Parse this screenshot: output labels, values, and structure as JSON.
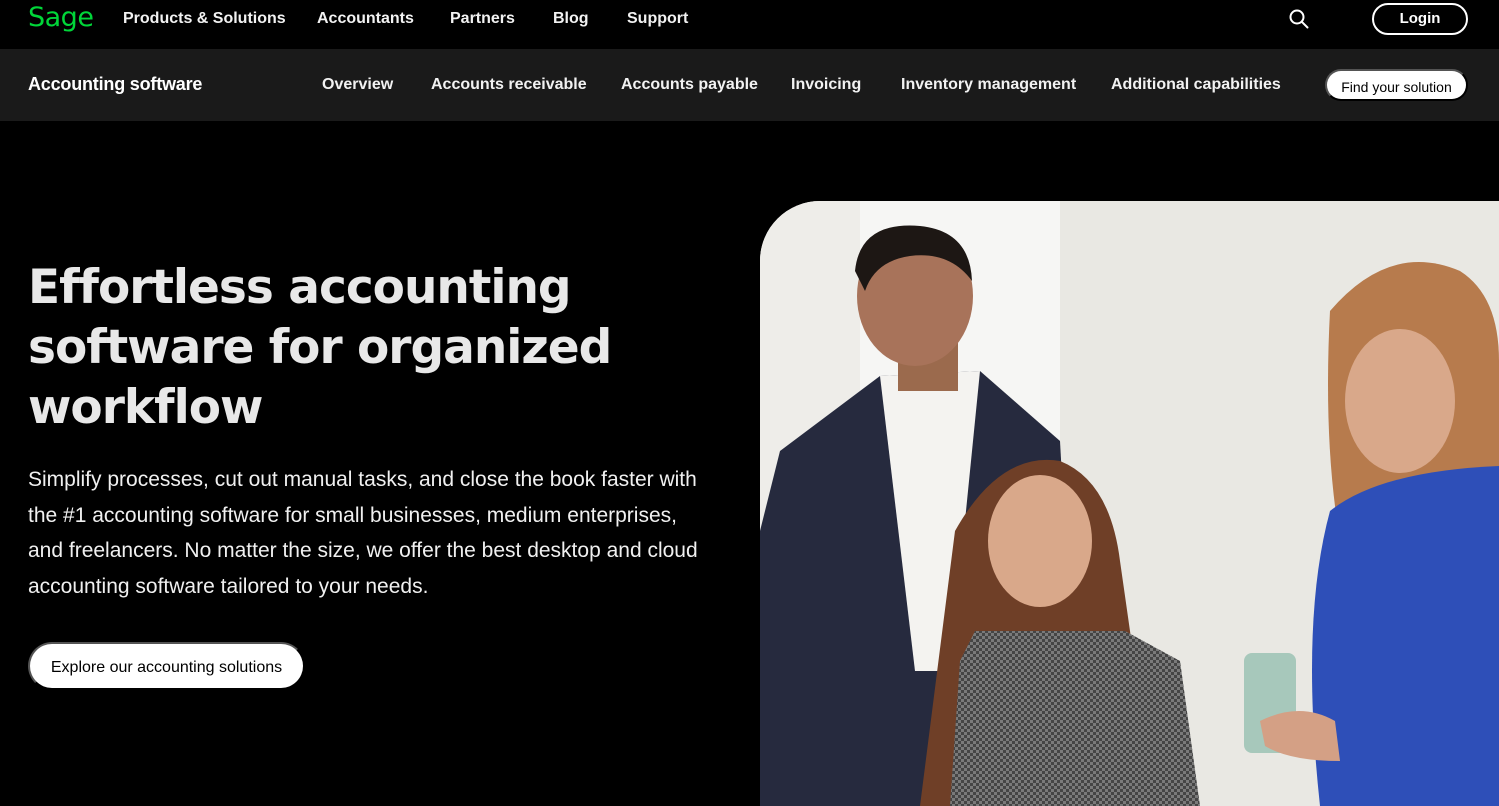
{
  "brand": {
    "logo_text": "Sage",
    "accent": "#00d639"
  },
  "topnav": {
    "links": [
      "Products & Solutions",
      "Accountants",
      "Partners",
      "Blog",
      "Support"
    ],
    "search_icon": "search-icon",
    "login_label": "Login"
  },
  "subnav": {
    "title": "Accounting software",
    "links": [
      "Overview",
      "Accounts receivable",
      "Accounts payable",
      "Invoicing",
      "Inventory management",
      "Additional capabilities"
    ],
    "cta_label": "Find your solution"
  },
  "hero": {
    "title": "Effortless accounting software for organized workflow",
    "body": "Simplify processes, cut out manual tasks, and close the book faster with the #1 accounting software for small businesses, medium enterprises, and freelancers. No matter the size, we offer the best desktop and cloud accounting software tailored to your needs.",
    "cta_label": "Explore our accounting solutions"
  }
}
